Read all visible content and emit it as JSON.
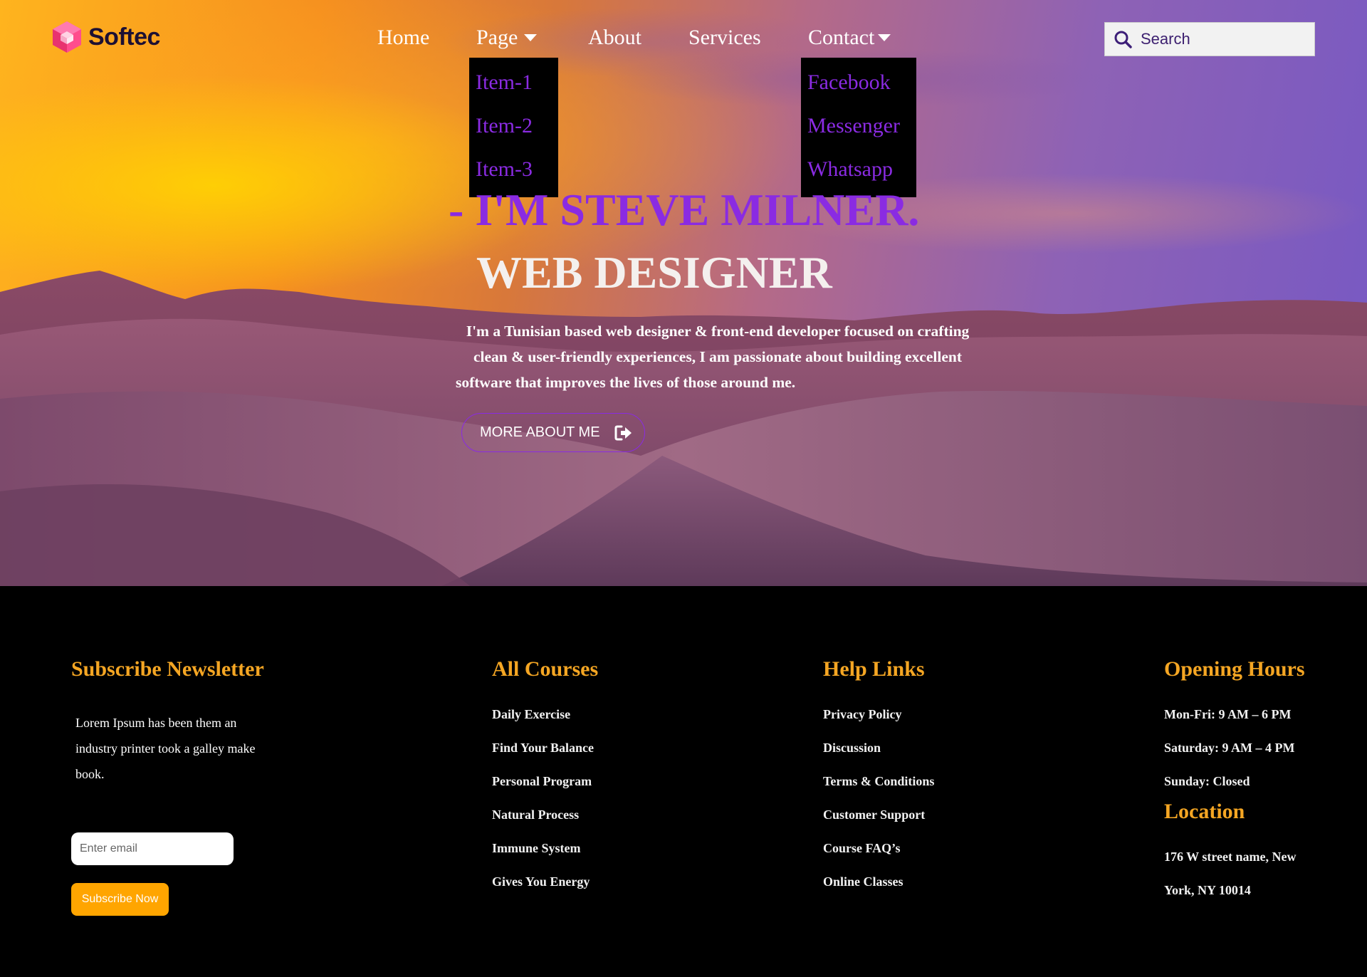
{
  "brand": {
    "name": "Softec"
  },
  "nav": {
    "items": [
      {
        "label": "Home"
      },
      {
        "label": "Page",
        "has_dropdown": true
      },
      {
        "label": "About"
      },
      {
        "label": "Services"
      },
      {
        "label": "Contact",
        "has_dropdown": true
      }
    ],
    "page_dropdown": [
      "Item-1",
      "Item-2",
      "Item-3"
    ],
    "contact_dropdown": [
      "Facebook",
      "Messenger",
      "Whatsapp"
    ]
  },
  "search": {
    "placeholder": "Search",
    "icon": "search-icon"
  },
  "hero": {
    "headline": "- I'M STEVE MILNER.",
    "subhead": "WEB DESIGNER",
    "bio_lines": [
      "I'm a Tunisian based web designer & front-end developer focused on crafting",
      "clean & user-friendly experiences, I am passionate about building excellent",
      "software that improves the lives of those around me."
    ],
    "button_label": "MORE ABOUT ME",
    "button_icon": "sign-out-icon"
  },
  "footer": {
    "newsletter": {
      "title": "Subscribe Newsletter",
      "text_lines": [
        "Lorem Ipsum has been them an",
        "industry printer took a galley make",
        "book."
      ],
      "email_placeholder": "Enter email",
      "button_label": "Subscribe Now"
    },
    "courses": {
      "title": "All Courses",
      "links": [
        "Daily Exercise",
        "Find Your Balance",
        "Personal Program",
        "Natural Process",
        "Immune System",
        "Gives You Energy"
      ]
    },
    "help": {
      "title": "Help Links",
      "links": [
        "Privacy Policy",
        "Discussion",
        "Terms & Conditions",
        "Customer Support",
        "Course FAQ’s",
        "Online Classes"
      ]
    },
    "hours": {
      "title": "Opening Hours",
      "lines": [
        "Mon-Fri: 9 AM – 6 PM",
        "Saturday: 9 AM – 4 PM",
        "Sunday: Closed"
      ]
    },
    "location": {
      "title": "Location",
      "lines": [
        "176 W street name, New",
        "York, NY 10014"
      ]
    }
  },
  "colors": {
    "accent_purple": "#8a2be2",
    "footer_heading": "#f5a623",
    "subscribe_button": "#ffa500"
  }
}
